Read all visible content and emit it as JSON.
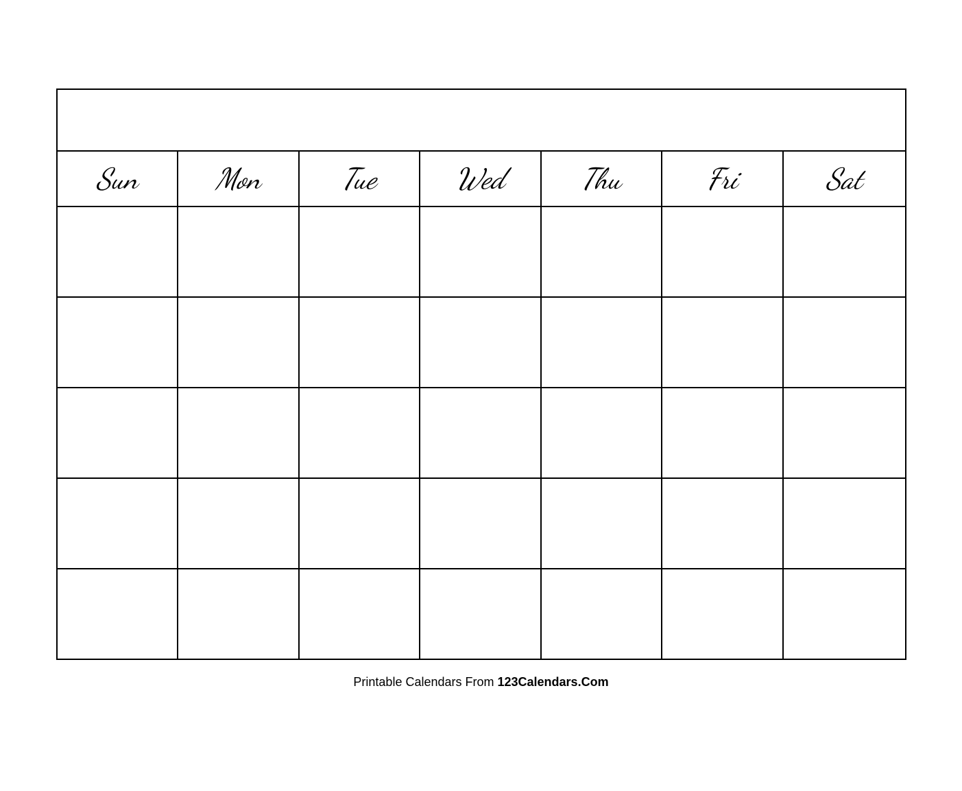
{
  "calendar": {
    "title": "",
    "days": [
      "Sun",
      "Mon",
      "Tue",
      "Wed",
      "Thu",
      "Fri",
      "Sat"
    ],
    "rows": 5
  },
  "footer": {
    "text_normal": "Printable Calendars From ",
    "text_bold": "123Calendars.Com"
  }
}
